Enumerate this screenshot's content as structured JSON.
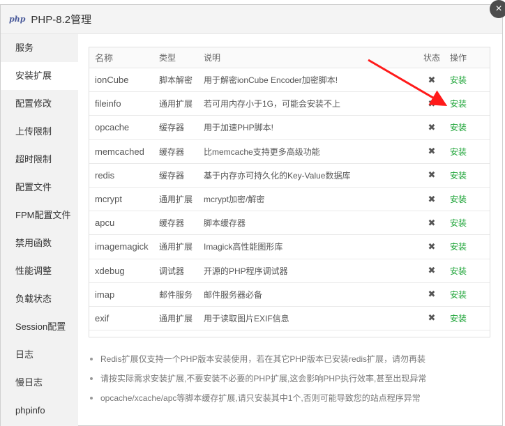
{
  "window": {
    "logo_text": "php",
    "title": "PHP-8.2管理",
    "close_glyph": "×"
  },
  "sidebar": {
    "items": [
      {
        "label": "服务"
      },
      {
        "label": "安装扩展"
      },
      {
        "label": "配置修改"
      },
      {
        "label": "上传限制"
      },
      {
        "label": "超时限制"
      },
      {
        "label": "配置文件"
      },
      {
        "label": "FPM配置文件"
      },
      {
        "label": "禁用函数"
      },
      {
        "label": "性能调整"
      },
      {
        "label": "负载状态"
      },
      {
        "label": "Session配置"
      },
      {
        "label": "日志"
      },
      {
        "label": "慢日志"
      },
      {
        "label": "phpinfo"
      }
    ],
    "active_index": 1
  },
  "table": {
    "headers": {
      "name": "名称",
      "type": "类型",
      "desc": "说明",
      "status": "状态",
      "action": "操作"
    },
    "status_glyph": "✖",
    "rows": [
      {
        "name": "ionCube",
        "type": "脚本解密",
        "desc": "用于解密ionCube Encoder加密脚本!",
        "action": "安装"
      },
      {
        "name": "fileinfo",
        "type": "通用扩展",
        "desc": "若可用内存小于1G，可能会安装不上",
        "action": "安装"
      },
      {
        "name": "opcache",
        "type": "缓存器",
        "desc": "用于加速PHP脚本!",
        "action": "安装"
      },
      {
        "name": "memcached",
        "type": "缓存器",
        "desc": "比memcache支持更多高级功能",
        "action": "安装"
      },
      {
        "name": "redis",
        "type": "缓存器",
        "desc": "基于内存亦可持久化的Key-Value数据库",
        "action": "安装"
      },
      {
        "name": "mcrypt",
        "type": "通用扩展",
        "desc": "mcrypt加密/解密",
        "action": "安装"
      },
      {
        "name": "apcu",
        "type": "缓存器",
        "desc": "脚本缓存器",
        "action": "安装"
      },
      {
        "name": "imagemagick",
        "type": "通用扩展",
        "desc": "Imagick高性能图形库",
        "action": "安装"
      },
      {
        "name": "xdebug",
        "type": "调试器",
        "desc": "开源的PHP程序调试器",
        "action": "安装"
      },
      {
        "name": "imap",
        "type": "邮件服务",
        "desc": "邮件服务器必备",
        "action": "安装"
      },
      {
        "name": "exif",
        "type": "通用扩展",
        "desc": "用于读取图片EXIF信息",
        "action": "安装"
      }
    ]
  },
  "notes": [
    "Redis扩展仅支持一个PHP版本安装使用，若在其它PHP版本已安装redis扩展，请勿再装",
    "请按实际需求安装扩展,不要安装不必要的PHP扩展,这会影响PHP执行效率,甚至出现异常",
    "opcache/xcache/apc等脚本缓存扩展,请只安装其中1个,否则可能导致您的站点程序异常"
  ],
  "colors": {
    "accent_green": "#20a53a",
    "arrow_red": "#ff1a1a"
  }
}
